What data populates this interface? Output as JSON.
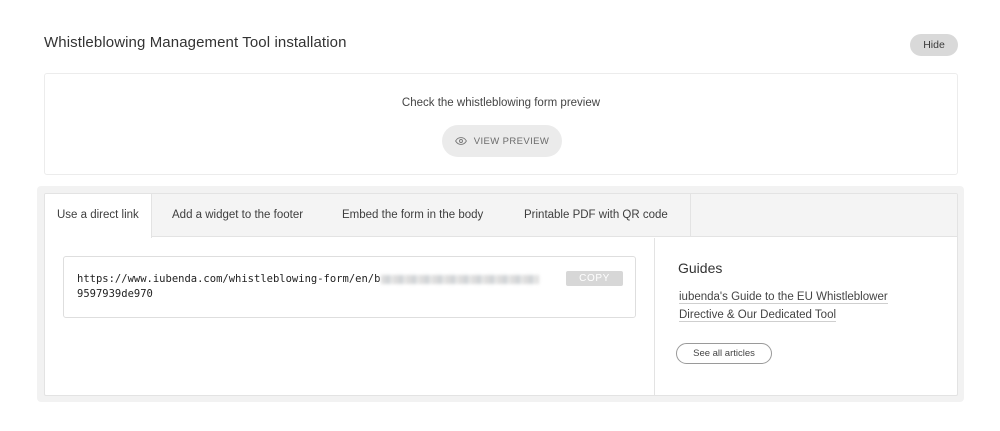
{
  "header": {
    "title": "Whistleblowing Management Tool installation",
    "hide_label": "Hide"
  },
  "preview": {
    "text": "Check the whistleblowing form preview",
    "button_label": "VIEW PREVIEW",
    "button_icon": "eye-icon"
  },
  "tabs": [
    {
      "label": "Use a direct link",
      "active": true
    },
    {
      "label": "Add a widget to the footer",
      "active": false
    },
    {
      "label": "Embed the form in the body",
      "active": false
    },
    {
      "label": "Printable PDF with QR code",
      "active": false
    }
  ],
  "direct_link": {
    "url_visible_start": "https://www.iubenda.com/whistleblowing-form/en/b",
    "url_visible_end": "9597939de970",
    "copy_label": "COPY"
  },
  "guides": {
    "title": "Guides",
    "link_label": "iubenda's Guide to the EU Whistleblower Directive & Our Dedicated Tool",
    "see_all_label": "See all articles"
  }
}
